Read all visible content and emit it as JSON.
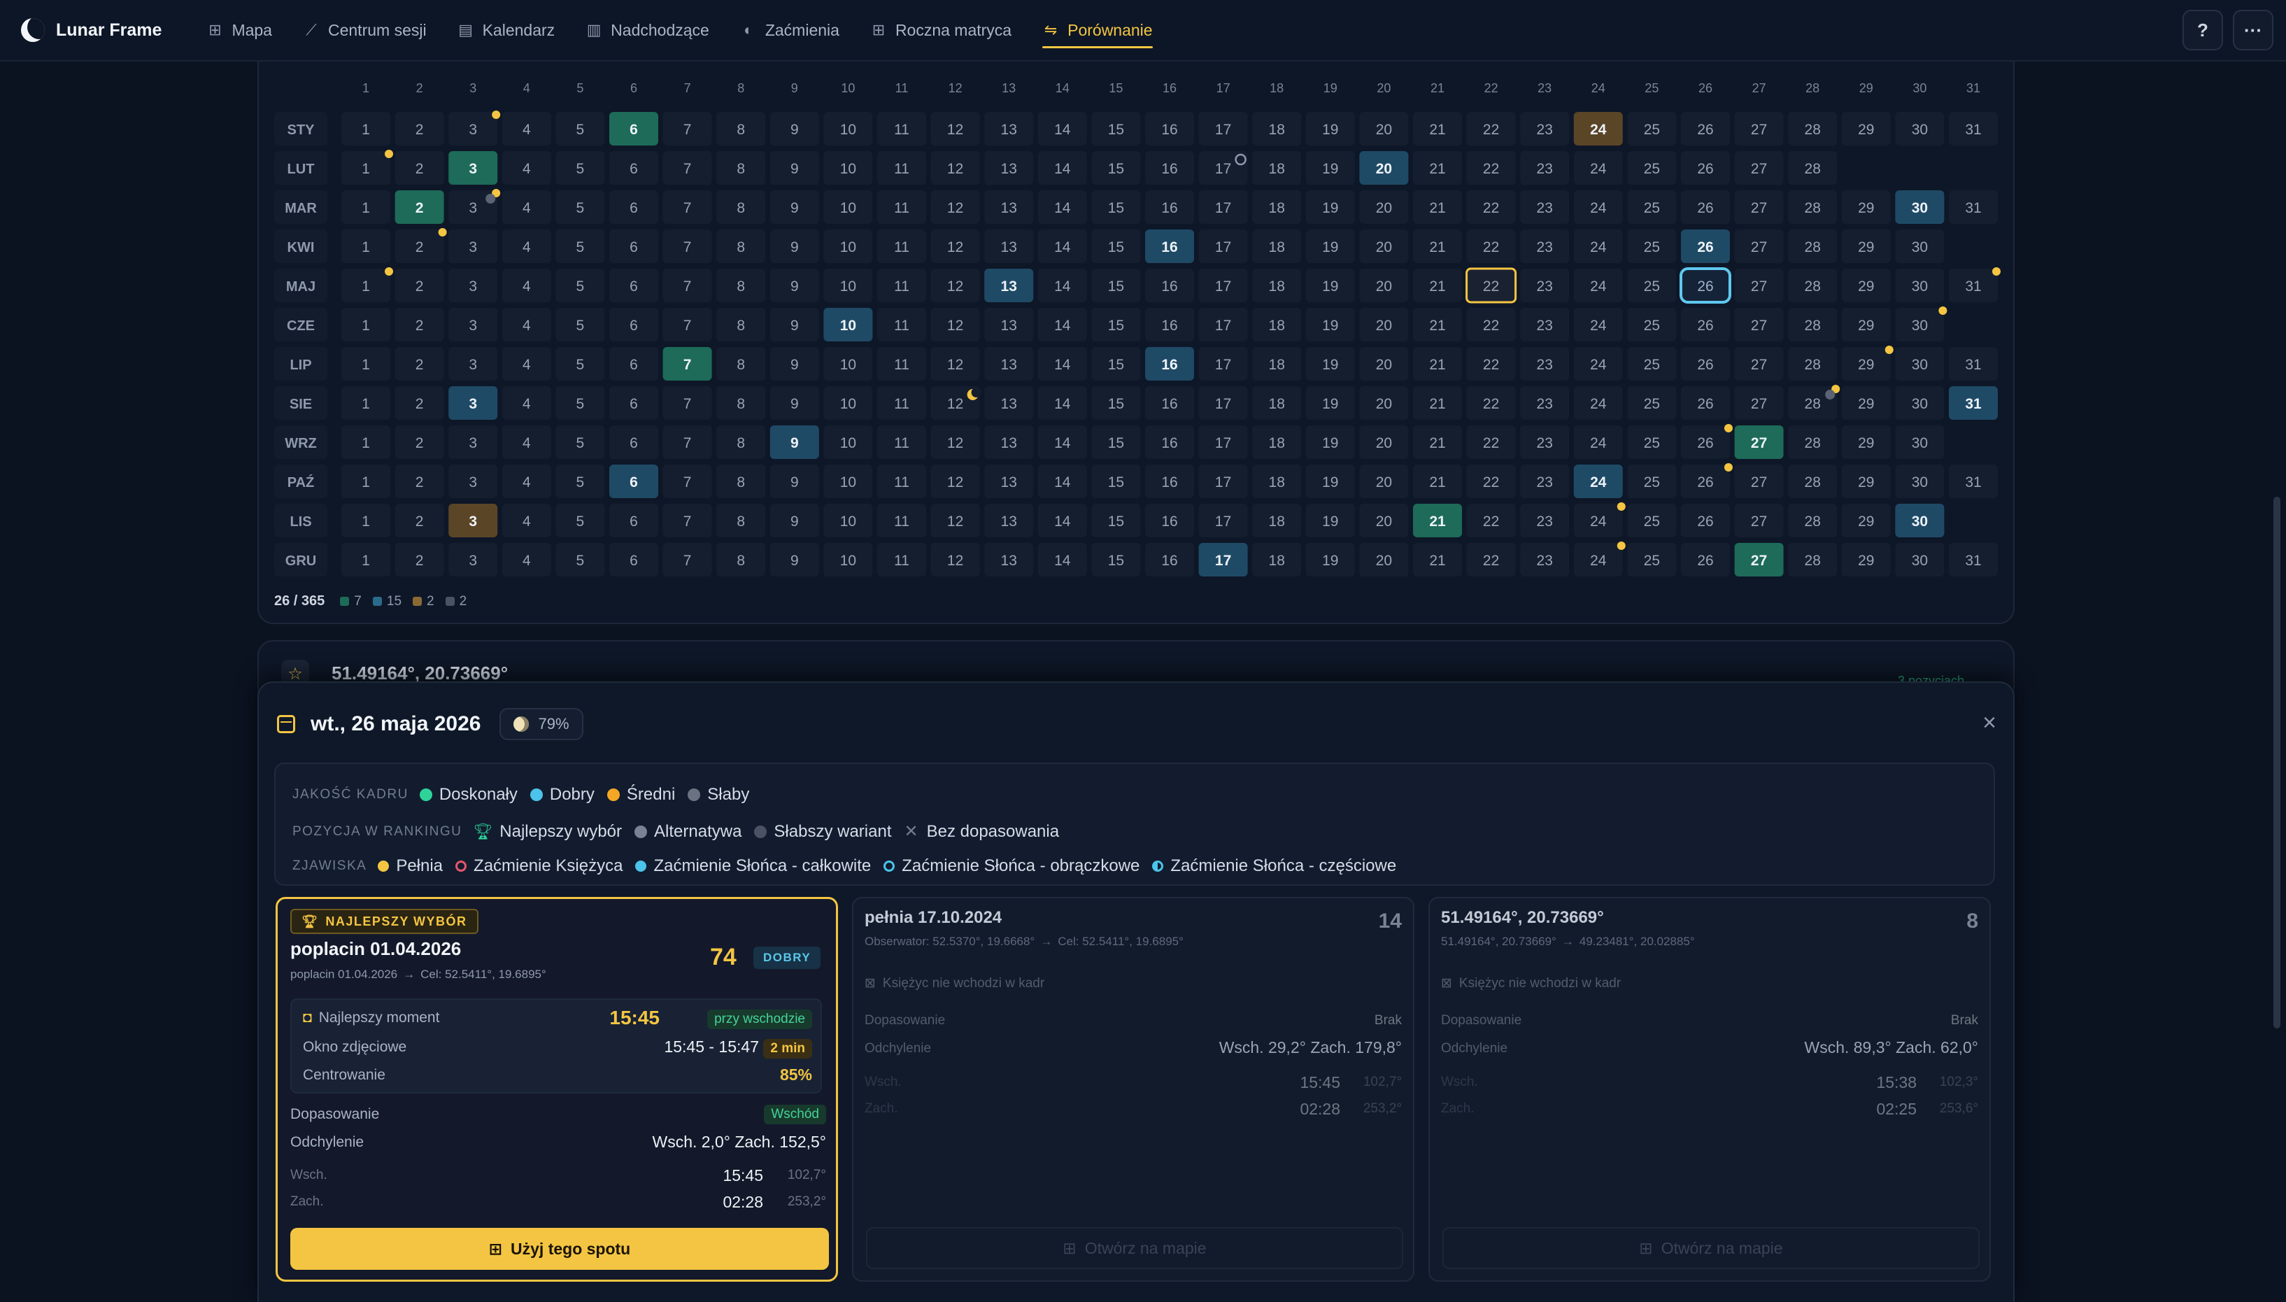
{
  "app": {
    "name": "Lunar Frame"
  },
  "nav": [
    {
      "label": "Mapa",
      "icon": "map-icon"
    },
    {
      "label": "Centrum sesji",
      "icon": "telescope-icon"
    },
    {
      "label": "Kalendarz",
      "icon": "calendar-icon"
    },
    {
      "label": "Nadchodzące",
      "icon": "calendar-clock-icon"
    },
    {
      "label": "Zaćmienia",
      "icon": "eclipse-icon"
    },
    {
      "label": "Roczna matryca",
      "icon": "grid-icon"
    },
    {
      "label": "Porównanie",
      "icon": "compare-icon",
      "active": true
    }
  ],
  "nav_actions": {
    "help": "?",
    "more": "···"
  },
  "calendar": {
    "day_headers": [
      "1",
      "2",
      "3",
      "4",
      "5",
      "6",
      "7",
      "8",
      "9",
      "10",
      "11",
      "12",
      "13",
      "14",
      "15",
      "16",
      "17",
      "18",
      "19",
      "20",
      "21",
      "22",
      "23",
      "24",
      "25",
      "26",
      "27",
      "28",
      "29",
      "30",
      "31"
    ],
    "months": [
      {
        "label": "STY",
        "days": 31
      },
      {
        "label": "LUT",
        "days": 28
      },
      {
        "label": "MAR",
        "days": 31
      },
      {
        "label": "KWI",
        "days": 30
      },
      {
        "label": "MAJ",
        "days": 31
      },
      {
        "label": "CZE",
        "days": 30
      },
      {
        "label": "LIP",
        "days": 31
      },
      {
        "label": "SIE",
        "days": 31
      },
      {
        "label": "WRZ",
        "days": 30
      },
      {
        "label": "PAŹ",
        "days": 31
      },
      {
        "label": "LIS",
        "days": 30
      },
      {
        "label": "GRU",
        "days": 31
      }
    ],
    "highlights": [
      {
        "m": 0,
        "d": 6,
        "q": "excellent"
      },
      {
        "m": 0,
        "d": 24,
        "q": "average"
      },
      {
        "m": 1,
        "d": 3,
        "q": "excellent"
      },
      {
        "m": 1,
        "d": 20,
        "q": "good"
      },
      {
        "m": 2,
        "d": 2,
        "q": "excellent"
      },
      {
        "m": 2,
        "d": 30,
        "q": "good"
      },
      {
        "m": 3,
        "d": 16,
        "q": "good"
      },
      {
        "m": 3,
        "d": 26,
        "q": "good"
      },
      {
        "m": 4,
        "d": 13,
        "q": "good"
      },
      {
        "m": 5,
        "d": 10,
        "q": "good"
      },
      {
        "m": 6,
        "d": 7,
        "q": "excellent"
      },
      {
        "m": 6,
        "d": 16,
        "q": "good"
      },
      {
        "m": 7,
        "d": 3,
        "q": "good"
      },
      {
        "m": 7,
        "d": 31,
        "q": "good"
      },
      {
        "m": 8,
        "d": 9,
        "q": "good"
      },
      {
        "m": 8,
        "d": 27,
        "q": "excellent"
      },
      {
        "m": 9,
        "d": 6,
        "q": "good"
      },
      {
        "m": 9,
        "d": 24,
        "q": "good"
      },
      {
        "m": 10,
        "d": 3,
        "q": "average"
      },
      {
        "m": 10,
        "d": 21,
        "q": "excellent"
      },
      {
        "m": 10,
        "d": 30,
        "q": "good"
      },
      {
        "m": 11,
        "d": 17,
        "q": "good"
      },
      {
        "m": 11,
        "d": 27,
        "q": "excellent"
      }
    ],
    "selected": {
      "m": 4,
      "d": 26
    },
    "today": {
      "m": 4,
      "d": 22
    },
    "full_moon_dots": [
      {
        "m": 0,
        "d": 3
      },
      {
        "m": 1,
        "d": 1
      },
      {
        "m": 2,
        "d": 3
      },
      {
        "m": 3,
        "d": 2
      },
      {
        "m": 4,
        "d": 1
      },
      {
        "m": 4,
        "d": 31
      },
      {
        "m": 5,
        "d": 30
      },
      {
        "m": 6,
        "d": 29
      },
      {
        "m": 7,
        "d": 28
      },
      {
        "m": 8,
        "d": 26
      },
      {
        "m": 9,
        "d": 26
      },
      {
        "m": 10,
        "d": 24
      },
      {
        "m": 11,
        "d": 24
      }
    ],
    "eclipse_markers": [
      {
        "m": 1,
        "d": 17,
        "kind": "ring"
      },
      {
        "m": 2,
        "d": 3,
        "kind": "grey"
      },
      {
        "m": 7,
        "d": 12,
        "kind": "crescent"
      },
      {
        "m": 7,
        "d": 28,
        "kind": "grey"
      }
    ],
    "colors": {
      "excellent": "#1d6b58",
      "good": "#1f4a66",
      "average": "#5b4527",
      "cell": "#141e2f"
    },
    "footer": {
      "count": "26 / 365",
      "legend": [
        {
          "value": "7",
          "color": "#1d6b58"
        },
        {
          "value": "15",
          "color": "#2a6b8c"
        },
        {
          "value": "2",
          "color": "#8a6a34"
        },
        {
          "value": "2",
          "color": "#4a5263"
        }
      ]
    }
  },
  "location_card": {
    "title": "51.49164°, 20.73669°",
    "badge": "3 pozycjach"
  },
  "panel": {
    "date_title": "wt., 26 maja 2026",
    "illumination": "79%",
    "legend": {
      "quality_label": "JAKOŚĆ KADRU",
      "quality": [
        {
          "label": "Doskonały",
          "color": "#2fd39a"
        },
        {
          "label": "Dobry",
          "color": "#4cc3ea"
        },
        {
          "label": "Średni",
          "color": "#f4a724"
        },
        {
          "label": "Słaby",
          "color": "#6b7382"
        }
      ],
      "rank_label": "POZYCJA W RANKINGU",
      "rank": [
        {
          "label": "Najlepszy wybór",
          "icon": "trophy-icon"
        },
        {
          "label": "Alternatywa",
          "icon": "dot-icon"
        },
        {
          "label": "Słabszy wariant",
          "icon": "dot-dim-icon"
        },
        {
          "label": "Bez dopasowania",
          "icon": "x-icon"
        }
      ],
      "phen_label": "ZJAWISKA",
      "phenomena": [
        {
          "label": "Pełnia",
          "color": "#f4c542",
          "style": "dot"
        },
        {
          "label": "Zaćmienie Księżyca",
          "color": "#e5566c",
          "style": "ring"
        },
        {
          "label": "Zaćmienie Słońca - całkowite",
          "color": "#4cc3ea",
          "style": "dot"
        },
        {
          "label": "Zaćmienie Słońca - obrączkowe",
          "color": "#4cc3ea",
          "style": "ring"
        },
        {
          "label": "Zaćmienie Słońca - częściowe",
          "color": "#4cc3ea",
          "style": "half"
        }
      ]
    },
    "options": [
      {
        "badge": "NAJLEPSZY WYBÓR",
        "name": "poplacin 01.04.2026",
        "sub": "poplacin 01.04.2026",
        "target": "Cel: 52.5411°, 19.6895°",
        "score": "74",
        "quality": "DOBRY",
        "best_moment_label": "Najlepszy moment",
        "best_moment_time": "15:45",
        "best_moment_tag": "przy wschodzie",
        "window_label": "Okno zdjęciowe",
        "window_value": "15:45 - 15:47",
        "window_tag": "2 min",
        "centering_label": "Centrowanie",
        "centering_value": "85%",
        "fit_label": "Dopasowanie",
        "fit_value": "Wschód",
        "dev_label": "Odchylenie",
        "dev_value": "Wsch. 2,0°  Zach. 152,5°",
        "rise_label": "Wsch.",
        "rise_time": "15:45",
        "rise_az": "102,7°",
        "set_label": "Zach.",
        "set_time": "02:28",
        "set_az": "253,2°",
        "cta": "Użyj tego spotu"
      },
      {
        "name": "pełnia 17.10.2024",
        "sub": "Obserwator: 52.5370°, 19.6668°",
        "target": "Cel: 52.5411°, 19.6895°",
        "score": "14",
        "note": "Księżyc nie wchodzi w kadr",
        "fit_label": "Dopasowanie",
        "fit_value": "Brak",
        "dev_label": "Odchylenie",
        "dev_value": "Wsch. 29,2°  Zach. 179,8°",
        "rise_label": "Wsch.",
        "rise_time": "15:45",
        "rise_az": "102,7°",
        "set_label": "Zach.",
        "set_time": "02:28",
        "set_az": "253,2°",
        "cta": "Otwórz na mapie"
      },
      {
        "name": "51.49164°, 20.73669°",
        "sub": "51.49164°, 20.73669°",
        "target": "49.23481°, 20.02885°",
        "score": "8",
        "note": "Księżyc nie wchodzi w kadr",
        "fit_label": "Dopasowanie",
        "fit_value": "Brak",
        "dev_label": "Odchylenie",
        "dev_value": "Wsch. 89,3°  Zach. 62,0°",
        "rise_label": "Wsch.",
        "rise_time": "15:38",
        "rise_az": "102,3°",
        "set_label": "Zach.",
        "set_time": "02:25",
        "set_az": "253,6°",
        "cta": "Otwórz na mapie"
      }
    ],
    "close": "×"
  }
}
